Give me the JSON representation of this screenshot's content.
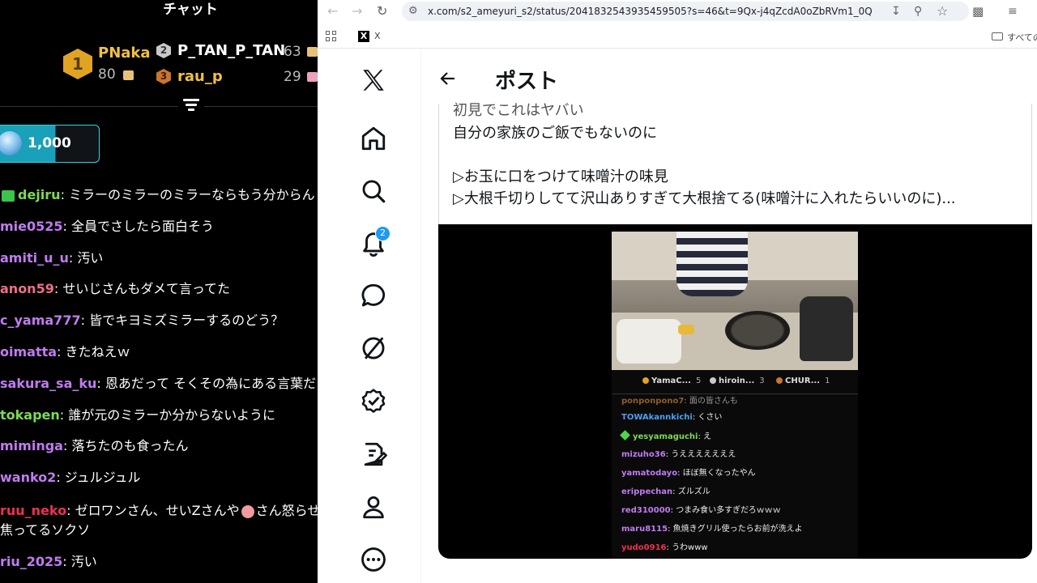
{
  "chat": {
    "title": "チャット",
    "ranking": [
      {
        "rank": "1",
        "name": "PNaka",
        "score": "80"
      },
      {
        "rank": "2",
        "name": "P_TAN_P_TAN",
        "score": "63"
      },
      {
        "rank": "3",
        "name": "rau_p",
        "score": "29"
      }
    ],
    "coin_value": "1,000",
    "messages": [
      {
        "user": "dejiru",
        "text": "ミラーのミラーのミラーならもう分からん",
        "color": "#7ed957",
        "badge": true
      },
      {
        "user": "mie0525",
        "text": "全員でさしたら面白そう",
        "color": "#c07cf0"
      },
      {
        "user": "amiti_u_u",
        "text": "汚い",
        "color": "#c07cf0"
      },
      {
        "user": "anon59",
        "text": "せいじさんもダメて言ってた",
        "color": "#f07088"
      },
      {
        "user": "c_yama777",
        "text": "皆でキヨミズミラーするのどう？",
        "color": "#c07cf0"
      },
      {
        "user": "oimatta",
        "text": "きたねえｗ",
        "color": "#c07cf0"
      },
      {
        "user": "sakura_sa_ku",
        "text": "恩あだって そくその為にある言葉だ",
        "color": "#c07cf0"
      },
      {
        "user": "tokapen",
        "text": "誰が元のミラーか分からないように",
        "color": "#7ed957"
      },
      {
        "user": "miminga",
        "text": "落ちたのも食ったん",
        "color": "#c07cf0"
      },
      {
        "user": "wanko2",
        "text": "ジュルジュル",
        "color": "#c07cf0"
      },
      {
        "user": "ruu_neko",
        "text": "ゼロワンさん、せいZさんや",
        "text2": "さん怒らせ",
        "color": "#f03050"
      },
      {
        "user": "",
        "text": "焦ってるソクソ",
        "color": "#fff"
      },
      {
        "user": "riu_2025",
        "text": "汚い",
        "color": "#c07cf0"
      }
    ]
  },
  "browser": {
    "url": "x.com/s2_ameyuri_s2/status/2041832543935459505?s=46&t=9Qx-j4qZcdA0oZbRVm1_0Q",
    "bookmark_label": "X",
    "bookmark_folder": "すべての"
  },
  "x": {
    "post_title": "ポスト",
    "notification_count": "2",
    "tweet_lines": [
      "初見でこれはヤバい",
      "自分の家族のご飯でもないのに",
      "",
      "▷お玉に口をつけて味噌汁の味見",
      "▷大根千切りしてて沢山ありすぎて大根捨てる(味噌汁に入れたらいいのに)..."
    ],
    "embedded": {
      "ranking": [
        {
          "name": "YamaC...",
          "score": "5",
          "color": "#e0a422"
        },
        {
          "name": "hiroin...",
          "score": "3",
          "color": "#c9c9c9"
        },
        {
          "name": "CHUR...",
          "score": "1",
          "color": "#c8762e"
        }
      ],
      "messages": [
        {
          "user": "ponponpono7",
          "text": "面の皆さんも",
          "color": "#e8943a"
        },
        {
          "user": "TOWAkannkichi",
          "text": "くさい",
          "color": "#4aa0f0"
        },
        {
          "user": "yesyamaguchi",
          "text": "え",
          "color": "#7ed957",
          "spark": true
        },
        {
          "user": "mizuho36",
          "text": "うえええええええ",
          "color": "#c07cf0"
        },
        {
          "user": "yamatodayo",
          "text": "ほぼ無くなったやん",
          "color": "#c07cf0"
        },
        {
          "user": "erippechan",
          "text": "ズルズル",
          "color": "#c07cf0"
        },
        {
          "user": "red310000",
          "text": "つまみ食い多すぎだろｗｗｗ",
          "color": "#c07cf0"
        },
        {
          "user": "maru8115",
          "text": "魚焼きグリル使ったらお前が洗えよ",
          "color": "#c07cf0"
        },
        {
          "user": "yudo0916",
          "text": "うわwww",
          "color": "#f03050"
        }
      ]
    }
  }
}
